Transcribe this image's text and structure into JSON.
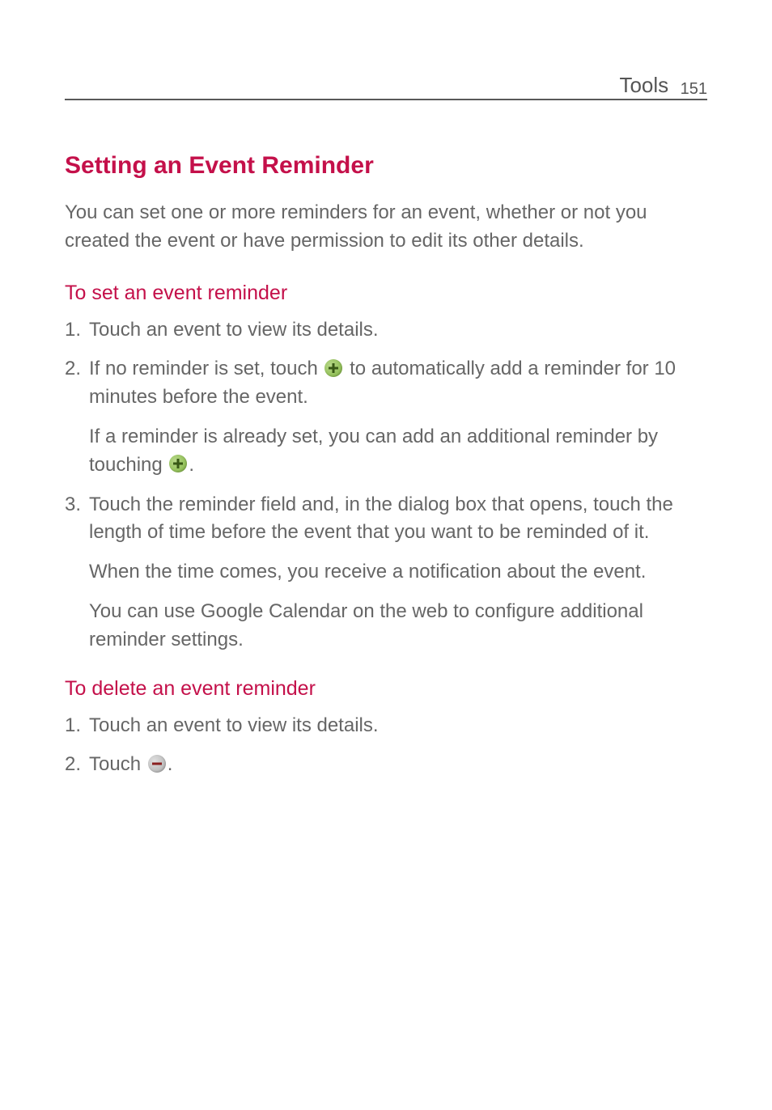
{
  "header": {
    "section": "Tools",
    "page_number": "151"
  },
  "main": {
    "heading": "Setting an Event Reminder",
    "intro": "You can set one or more reminders for an event, whether or not you created the event or have permission to edit its other details.",
    "section_set": {
      "heading": "To set an event reminder",
      "item1_num": "1.",
      "item1_text": "Touch an event to view its details.",
      "item2_num": "2.",
      "item2_part1": "If no reminder is set, touch ",
      "item2_part2": " to automatically add a reminder for 10 minutes before the event.",
      "item2_sub1_part1": "If a reminder is already set, you can add an additional reminder by touching ",
      "item2_sub1_part2": ".",
      "item3_num": "3.",
      "item3_text": "Touch the reminder field and, in the dialog box that opens, touch the length of time before the event that you want to be reminded of it.",
      "item3_sub1": "When the time comes, you receive a notification about the event.",
      "item3_sub2": "You can use Google Calendar on the web to configure additional reminder settings."
    },
    "section_delete": {
      "heading": "To delete an event reminder",
      "item1_num": "1.",
      "item1_text": "Touch an event to view its details.",
      "item2_num": "2.",
      "item2_part1": "Touch ",
      "item2_part2": "."
    }
  }
}
